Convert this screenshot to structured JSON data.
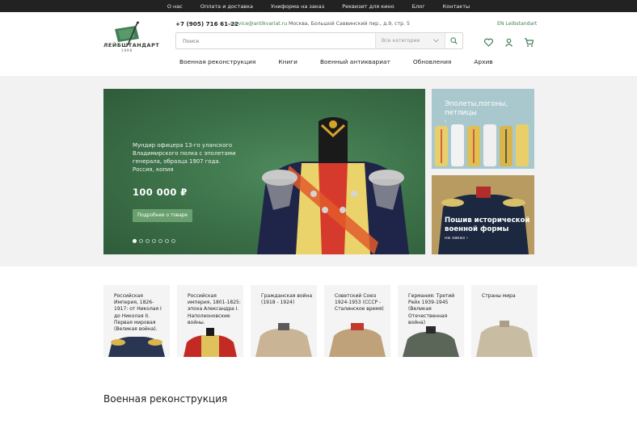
{
  "topbar": {
    "links": [
      "О нас",
      "Оплата и доставка",
      "Униформа на заказ",
      "Реквизит для кино",
      "Блог",
      "Контакты"
    ]
  },
  "header": {
    "logo_text": "ЛЕЙБШТАНДАРТ",
    "logo_year": "1998",
    "phone": "+7 (905) 716 61-22",
    "email": "service@antikvariat.ru",
    "address": "Москва, Большой Саввинский пер., д.9, стр. 5",
    "lang": "EN Leibstandart",
    "search": {
      "placeholder": "Поиск",
      "category_label": "Все категории"
    },
    "icons": [
      "heart-icon",
      "user-icon",
      "cart-icon"
    ]
  },
  "nav": {
    "items": [
      "Военная реконструкция",
      "Книги",
      "Военный антиквариат",
      "Обновления",
      "Архив"
    ]
  },
  "hero": {
    "description": "Мундир офицера 13-го уланского Владимирского полка с эполетами генерала, образца 1907 года. Россия, копия",
    "price": "100 000 ₽",
    "button": "Подробнее о товаре",
    "slide_count": 7,
    "active_slide": 1
  },
  "side_banners": [
    {
      "title": "Эполеты,погоны, петлицы",
      "arrow": "›"
    },
    {
      "title": "Пошив исторической военной формы",
      "subtitle": "на заказ ›"
    }
  ],
  "categories": [
    "Российская Империя, 1826-1917: от Николая I до Николая II. Первая мировая (Великая война).",
    "Российская империя, 1801-1825: эпоха Александра I. Наполеоновские войны.",
    "Гражданская война (1918 - 1924)",
    "Советский Союз 1924-1953 (СССР - Сталинское время)",
    "Германия: Третий Рейх 1939-1945 (Великая Отечественная война)",
    "Страны мира"
  ],
  "section_title": "Военная реконструкция",
  "colors": {
    "brand_green": "#3f7f54",
    "hero_green": "#3b6f47",
    "topbar": "#222222"
  }
}
